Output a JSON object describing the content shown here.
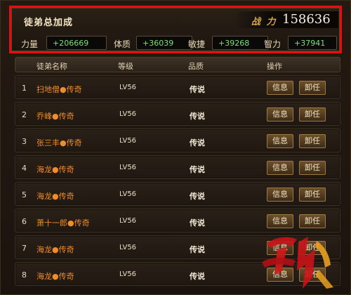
{
  "summary": {
    "title": "徒弟总加成",
    "power_label": "战 力",
    "power_value": "158636",
    "stats": [
      {
        "label": "力量",
        "value": "+206669"
      },
      {
        "label": "体质",
        "value": "+36039"
      },
      {
        "label": "敏捷",
        "value": "+39268"
      },
      {
        "label": "智力",
        "value": "+37941"
      }
    ]
  },
  "table": {
    "headers": [
      "徒弟名称",
      "等级",
      "品质",
      "操作"
    ],
    "rows": [
      {
        "index": "1",
        "name": "扫地僧●传奇",
        "level": "LV56",
        "quality": "传说",
        "info": "信息",
        "dismiss": "卸任"
      },
      {
        "index": "2",
        "name": "乔峰●传奇",
        "level": "LV56",
        "quality": "传说",
        "info": "信息",
        "dismiss": "卸任"
      },
      {
        "index": "3",
        "name": "张三丰●传奇",
        "level": "LV56",
        "quality": "传说",
        "info": "信息",
        "dismiss": "卸任"
      },
      {
        "index": "4",
        "name": "海龙●传奇",
        "level": "LV56",
        "quality": "传说",
        "info": "信息",
        "dismiss": "卸任"
      },
      {
        "index": "5",
        "name": "海龙●传奇",
        "level": "LV56",
        "quality": "传说",
        "info": "信息",
        "dismiss": "卸任"
      },
      {
        "index": "6",
        "name": "萧十一郎●传奇",
        "level": "LV56",
        "quality": "传说",
        "info": "信息",
        "dismiss": "卸任"
      },
      {
        "index": "7",
        "name": "海龙●传奇",
        "level": "LV56",
        "quality": "传说",
        "info": "信息",
        "dismiss": "卸任"
      },
      {
        "index": "8",
        "name": "海龙●传奇",
        "level": "LV56",
        "quality": "传说",
        "info": "信息",
        "dismiss": "卸任"
      }
    ]
  },
  "colors": {
    "highlight_border": "#e01010",
    "name_text": "#f08c2a",
    "stat_value_text": "#7ce07a",
    "button_bg": "#6b4f2b"
  },
  "watermark": {
    "icon": "site-logo-watermark"
  }
}
